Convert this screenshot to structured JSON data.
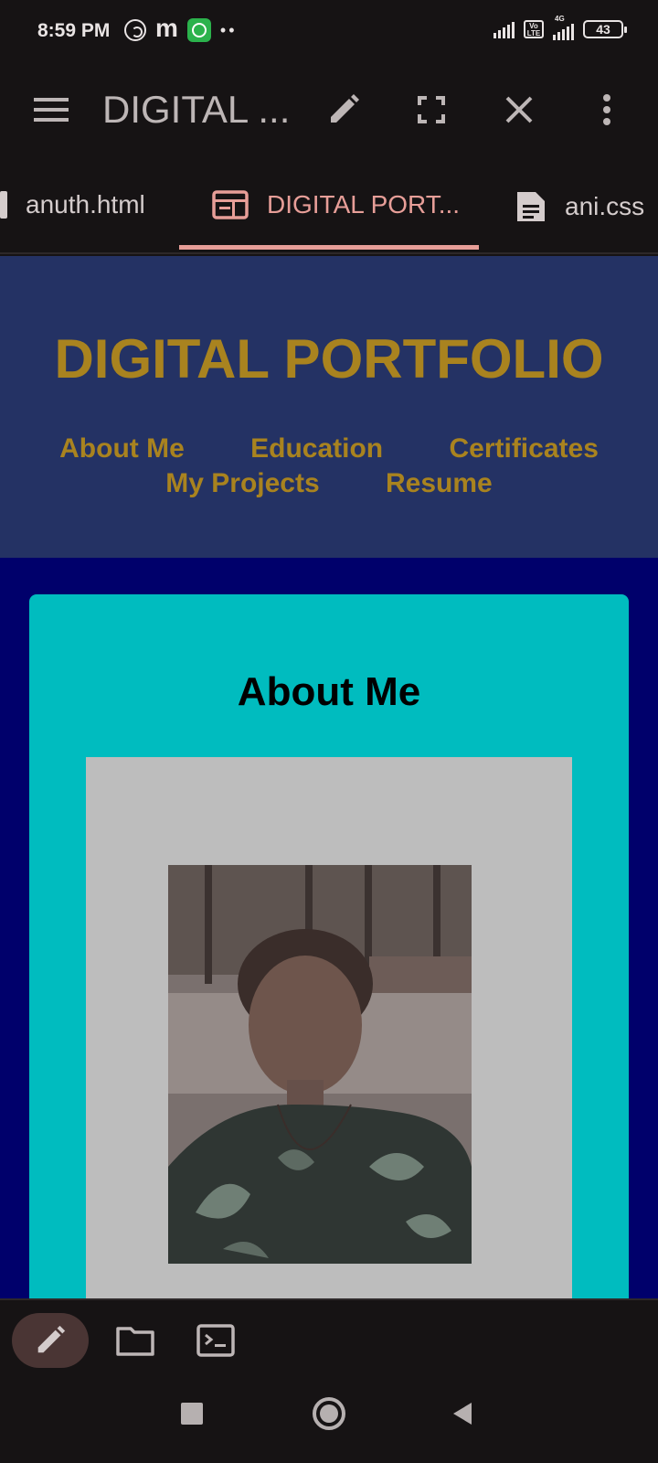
{
  "status_bar": {
    "time": "8:59 PM",
    "icons_left": [
      "whatsapp-outline-icon",
      "m-app-icon",
      "whatsapp-icon",
      "more-dots-icon"
    ],
    "icons_right": [
      "signal-icon",
      "volte-icon",
      "4g-signal-icon",
      "battery-icon"
    ],
    "volte_label": "Vo LTE",
    "network_label": "4G",
    "battery": "43"
  },
  "app_bar": {
    "title": "DIGITAL ...",
    "icons": [
      "menu-icon",
      "edit-icon",
      "fullscreen-icon",
      "close-icon",
      "more-vert-icon"
    ]
  },
  "tabs": [
    {
      "label": "anuth.html",
      "active": false
    },
    {
      "label": "DIGITAL PORT...",
      "active": true
    },
    {
      "label": "ani.css",
      "active": false
    }
  ],
  "page": {
    "title": "DIGITAL PORTFOLIO",
    "nav": [
      "About Me",
      "Education",
      "Certificates",
      "My Projects",
      "Resume"
    ],
    "about_title": "About Me"
  },
  "colors": {
    "header_bg": "#243264",
    "body_bg": "#00006b",
    "gold": "#a9831f",
    "card_bg": "#00bcbf",
    "accent": "#e79e98"
  },
  "bottom_toolbar": [
    "edit-icon",
    "folder-icon",
    "terminal-icon"
  ],
  "system_nav": [
    "recents-icon",
    "home-icon",
    "back-icon"
  ]
}
